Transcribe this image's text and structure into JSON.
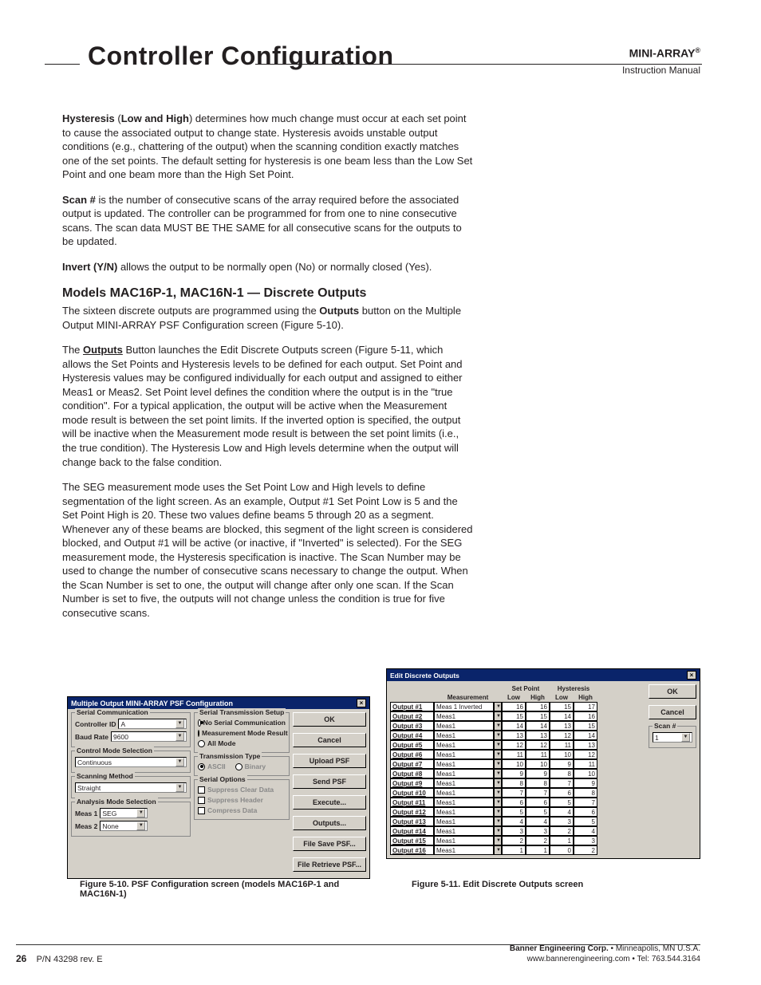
{
  "header": {
    "title": "Controller Configuration",
    "brand": "MINI-ARRAY",
    "brand_reg": "®",
    "subtitle": "Instruction Manual"
  },
  "body": {
    "p1a": "Hysteresis",
    "p1b": " (",
    "p1c": "Low and High",
    "p1d": ") determines how much change must occur at each set point to cause the associated output to change state. Hysteresis avoids unstable output conditions (e.g., chattering of the output) when the scanning condition exactly matches one of the set points. The default setting for hysteresis is one beam less than the Low Set Point and one beam more than the High Set Point.",
    "p2a": "Scan #",
    "p2b": " is the number of consecutive scans of the array required before the associated output is updated. The controller can be programmed for from one to nine consecutive scans. The scan data MUST BE THE SAME for all consecutive scans for the outputs to be updated.",
    "p3a": "Invert (Y/N)",
    "p3b": " allows the output to be normally open (No) or normally closed (Yes).",
    "h1": "Models MAC16P-1, MAC16N-1 — Discrete Outputs",
    "p4a": "The sixteen discrete outputs are programmed using the ",
    "p4b": "Outputs",
    "p4c": " button on the Multiple Output MINI-ARRAY PSF Configuration screen (Figure 5-10).",
    "p5a": "The ",
    "p5b": "Outputs",
    "p5c": " Button launches the Edit Discrete Outputs screen (Figure 5-11, which allows the Set Points and Hysteresis levels to be defined for each output. Set Point and Hysteresis values may be configured individually for each output and assigned to either Meas1 or Meas2. Set Point level defines the condition where the output is in the \"true condition\". For a typical application, the output will be active when the Measurement mode result is between the set point limits. If the inverted option is specified, the output will be inactive when the Measurement mode result is between the set point limits (i.e., the true condition). The Hysteresis Low and High levels determine when the output will change back to the false condition.",
    "p6": "The SEG measurement mode uses the Set Point Low and High levels to define segmentation of the light screen. As an example, Output #1 Set Point Low is 5 and the Set Point High is 20. These two values define beams 5 through 20 as a segment. Whenever any of these beams are blocked, this segment of the light screen is considered blocked, and Output #1 will be active (or inactive, if \"Inverted\" is selected). For the SEG measurement mode, the Hysteresis specification is inactive. The Scan Number may be used to change the number of consecutive scans necessary to change the output. When the Scan Number is set to one, the output will change after only one scan. If the Scan Number is set to five, the outputs will not change unless the condition is true for five consecutive scans."
  },
  "fig510": {
    "title": "Multiple Output MINI-ARRAY PSF Configuration",
    "serial_comm": "Serial Communication",
    "controller_id_lbl": "Controller ID",
    "controller_id_val": "A",
    "baud_lbl": "Baud Rate",
    "baud_val": "9600",
    "cms_title": "Control Mode Selection",
    "cms_val": "Continuous",
    "scan_title": "Scanning Method",
    "scan_val": "Straight",
    "ams_title": "Analysis Mode Selection",
    "meas1_lbl": "Meas 1",
    "meas1_val": "SEG",
    "meas2_lbl": "Meas 2",
    "meas2_val": "None",
    "sts_title": "Serial Transmission Setup",
    "opt_nosc": "No Serial Communication",
    "opt_mmr": "Measurement Mode Result",
    "opt_all": "All Mode",
    "tt_title": "Transmission Type",
    "opt_ascii": "ASCII",
    "opt_binary": "Binary",
    "so_title": "Serial Options",
    "opt_scd": "Suppress Clear Data",
    "opt_sh": "Suppress Header",
    "opt_cd": "Compress Data",
    "btn_ok": "OK",
    "btn_cancel": "Cancel",
    "btn_upload": "Upload PSF",
    "btn_send": "Send PSF",
    "btn_exec": "Execute...",
    "btn_outputs": "Outputs...",
    "btn_save": "File Save PSF...",
    "btn_retrieve": "File Retrieve PSF...",
    "caption": "Figure 5-10. PSF Configuration screen (models MAC16P-1 and MAC16N-1)"
  },
  "fig511": {
    "title": "Edit Discrete Outputs",
    "hdr_meas": "Measurement",
    "hdr_sp": "Set Point",
    "hdr_hy": "Hysteresis",
    "hdr_low": "Low",
    "hdr_high": "High",
    "btn_ok": "OK",
    "btn_cancel": "Cancel",
    "scan_title": "Scan #",
    "scan_val": "1",
    "rows": [
      {
        "o": "Output #1",
        "m": "Meas 1 Inverted",
        "sl": 16,
        "sh": 16,
        "hl": 15,
        "hh": 17
      },
      {
        "o": "Output #2",
        "m": "Meas1",
        "sl": 15,
        "sh": 15,
        "hl": 14,
        "hh": 16
      },
      {
        "o": "Output #3",
        "m": "Meas1",
        "sl": 14,
        "sh": 14,
        "hl": 13,
        "hh": 15
      },
      {
        "o": "Output #4",
        "m": "Meas1",
        "sl": 13,
        "sh": 13,
        "hl": 12,
        "hh": 14
      },
      {
        "o": "Output #5",
        "m": "Meas1",
        "sl": 12,
        "sh": 12,
        "hl": 11,
        "hh": 13
      },
      {
        "o": "Output #6",
        "m": "Meas1",
        "sl": 11,
        "sh": 11,
        "hl": 10,
        "hh": 12
      },
      {
        "o": "Output #7",
        "m": "Meas1",
        "sl": 10,
        "sh": 10,
        "hl": 9,
        "hh": 11
      },
      {
        "o": "Output #8",
        "m": "Meas1",
        "sl": 9,
        "sh": 9,
        "hl": 8,
        "hh": 10
      },
      {
        "o": "Output #9",
        "m": "Meas1",
        "sl": 8,
        "sh": 8,
        "hl": 7,
        "hh": 9
      },
      {
        "o": "Output #10",
        "m": "Meas1",
        "sl": 7,
        "sh": 7,
        "hl": 6,
        "hh": 8
      },
      {
        "o": "Output #11",
        "m": "Meas1",
        "sl": 6,
        "sh": 6,
        "hl": 5,
        "hh": 7
      },
      {
        "o": "Output #12",
        "m": "Meas1",
        "sl": 5,
        "sh": 5,
        "hl": 4,
        "hh": 6
      },
      {
        "o": "Output #13",
        "m": "Meas1",
        "sl": 4,
        "sh": 4,
        "hl": 3,
        "hh": 5
      },
      {
        "o": "Output #14",
        "m": "Meas1",
        "sl": 3,
        "sh": 3,
        "hl": 2,
        "hh": 4
      },
      {
        "o": "Output #15",
        "m": "Meas1",
        "sl": 2,
        "sh": 2,
        "hl": 1,
        "hh": 3
      },
      {
        "o": "Output #16",
        "m": "Meas1",
        "sl": 1,
        "sh": 1,
        "hl": 0,
        "hh": 2
      }
    ],
    "caption": "Figure 5-11.  Edit Discrete Outputs screen"
  },
  "footer": {
    "page": "26",
    "pn": "P/N 43298 rev. E",
    "corp": "Banner Engineering Corp.",
    "addr": " • Minneapolis, MN U.S.A.",
    "web": "www.bannerengineering.com  •  Tel: 763.544.3164"
  }
}
